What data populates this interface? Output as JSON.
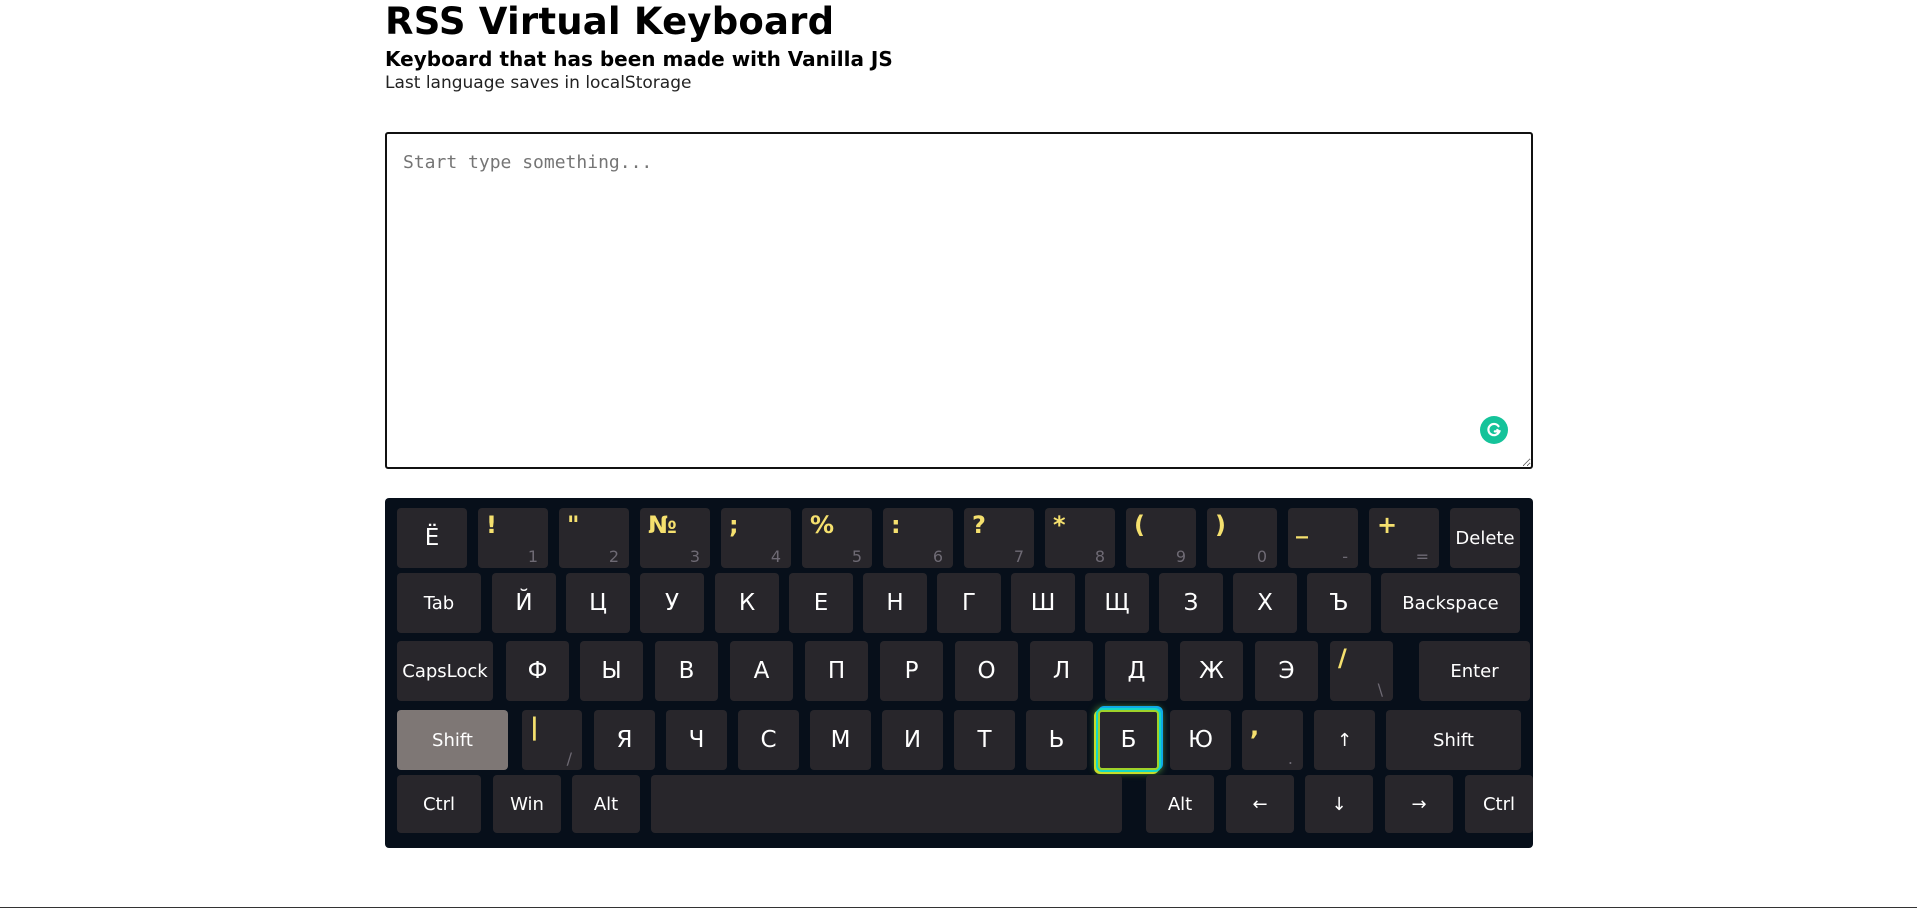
{
  "header": {
    "title": "RSS Virtual Keyboard",
    "subtitle": "Keyboard that has been made with Vanilla JS",
    "note": "Last language saves in localStorage"
  },
  "textarea": {
    "placeholder": "Start type something...",
    "value": ""
  },
  "keyboard": {
    "language": "ru",
    "active_modifier": "ShiftLeft",
    "highlighted_key": "Б",
    "rows": [
      [
        {
          "label": "Ё",
          "type": "char"
        },
        {
          "alt": "!",
          "base": "1",
          "type": "dual"
        },
        {
          "alt": "\"",
          "base": "2",
          "type": "dual"
        },
        {
          "alt": "№",
          "base": "3",
          "type": "dual"
        },
        {
          "alt": ";",
          "base": "4",
          "type": "dual"
        },
        {
          "alt": "%",
          "base": "5",
          "type": "dual"
        },
        {
          "alt": ":",
          "base": "6",
          "type": "dual"
        },
        {
          "alt": "?",
          "base": "7",
          "type": "dual"
        },
        {
          "alt": "*",
          "base": "8",
          "type": "dual"
        },
        {
          "alt": "(",
          "base": "9",
          "type": "dual"
        },
        {
          "alt": ")",
          "base": "0",
          "type": "dual"
        },
        {
          "alt": "_",
          "base": "-",
          "type": "dual"
        },
        {
          "alt": "+",
          "base": "=",
          "type": "dual"
        },
        {
          "label": "Delete",
          "type": "word"
        }
      ],
      [
        {
          "label": "Tab",
          "type": "word"
        },
        {
          "label": "Й",
          "type": "char"
        },
        {
          "label": "Ц",
          "type": "char"
        },
        {
          "label": "У",
          "type": "char"
        },
        {
          "label": "К",
          "type": "char"
        },
        {
          "label": "Е",
          "type": "char"
        },
        {
          "label": "Н",
          "type": "char"
        },
        {
          "label": "Г",
          "type": "char"
        },
        {
          "label": "Ш",
          "type": "char"
        },
        {
          "label": "Щ",
          "type": "char"
        },
        {
          "label": "З",
          "type": "char"
        },
        {
          "label": "Х",
          "type": "char"
        },
        {
          "label": "Ъ",
          "type": "char"
        },
        {
          "label": "Backspace",
          "type": "word"
        }
      ],
      [
        {
          "label": "CapsLock",
          "type": "word"
        },
        {
          "label": "Ф",
          "type": "char"
        },
        {
          "label": "Ы",
          "type": "char"
        },
        {
          "label": "В",
          "type": "char"
        },
        {
          "label": "А",
          "type": "char"
        },
        {
          "label": "П",
          "type": "char"
        },
        {
          "label": "Р",
          "type": "char"
        },
        {
          "label": "О",
          "type": "char"
        },
        {
          "label": "Л",
          "type": "char"
        },
        {
          "label": "Д",
          "type": "char"
        },
        {
          "label": "Ж",
          "type": "char"
        },
        {
          "label": "Э",
          "type": "char"
        },
        {
          "alt": "/",
          "base": "\\",
          "type": "dual"
        },
        {
          "label": "Enter",
          "type": "word"
        }
      ],
      [
        {
          "label": "Shift",
          "type": "word",
          "state": "active"
        },
        {
          "alt": "|",
          "base": "/",
          "type": "dual"
        },
        {
          "label": "Я",
          "type": "char"
        },
        {
          "label": "Ч",
          "type": "char"
        },
        {
          "label": "С",
          "type": "char"
        },
        {
          "label": "М",
          "type": "char"
        },
        {
          "label": "И",
          "type": "char"
        },
        {
          "label": "Т",
          "type": "char"
        },
        {
          "label": "Ь",
          "type": "char"
        },
        {
          "label": "Б",
          "type": "char",
          "state": "highlighted"
        },
        {
          "label": "Ю",
          "type": "char"
        },
        {
          "alt": ",",
          "base": ".",
          "type": "dual"
        },
        {
          "label": "↑",
          "type": "fn"
        },
        {
          "label": "Shift",
          "type": "word"
        }
      ],
      [
        {
          "label": "Ctrl",
          "type": "word"
        },
        {
          "label": "Win",
          "type": "word"
        },
        {
          "label": "Alt",
          "type": "word"
        },
        {
          "label": "",
          "type": "space"
        },
        {
          "label": "Alt",
          "type": "word"
        },
        {
          "label": "←",
          "type": "fn"
        },
        {
          "label": "↓",
          "type": "fn"
        },
        {
          "label": "→",
          "type": "fn"
        },
        {
          "label": "Ctrl",
          "type": "word"
        }
      ]
    ]
  }
}
